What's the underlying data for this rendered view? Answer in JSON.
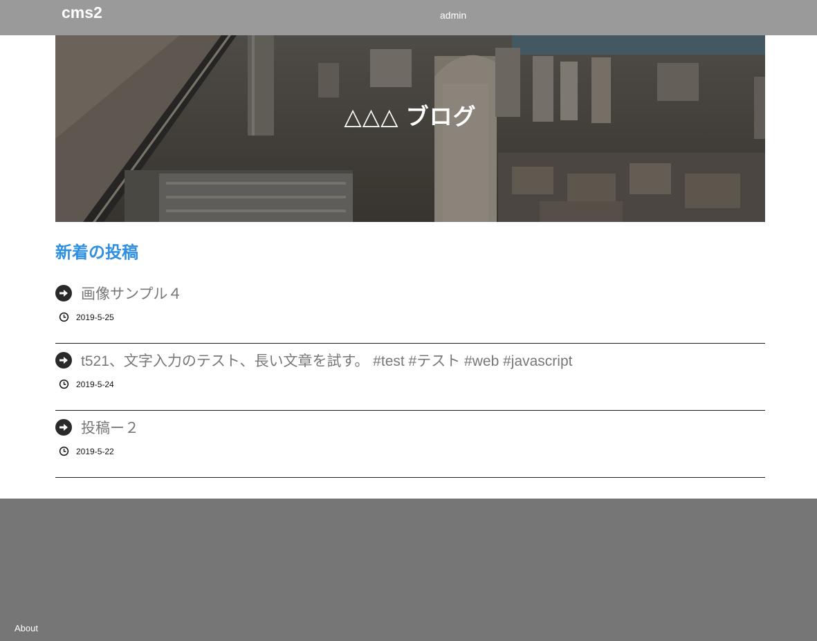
{
  "header": {
    "brand": "cms2",
    "admin_link": "admin",
    "background_color": "#9a9a9a"
  },
  "hero": {
    "title": "△△△ ブログ",
    "image": "city-skyline-aerial"
  },
  "main": {
    "section_title": "新着の投稿",
    "accent_color": "#2e8fe3",
    "posts": [
      {
        "title": "画像サンプル４",
        "date": "2019-5-25",
        "icon": "arrow-right-circle-icon"
      },
      {
        "title": "t521、文字入力のテスト、長い文章を試す。 #test #テスト #web #javascript",
        "date": "2019-5-24",
        "icon": "arrow-right-circle-icon"
      },
      {
        "title": "投稿ー２",
        "date": "2019-5-22",
        "icon": "arrow-right-circle-icon"
      }
    ]
  },
  "footer": {
    "about_link": "About",
    "background_color": "#767676"
  }
}
